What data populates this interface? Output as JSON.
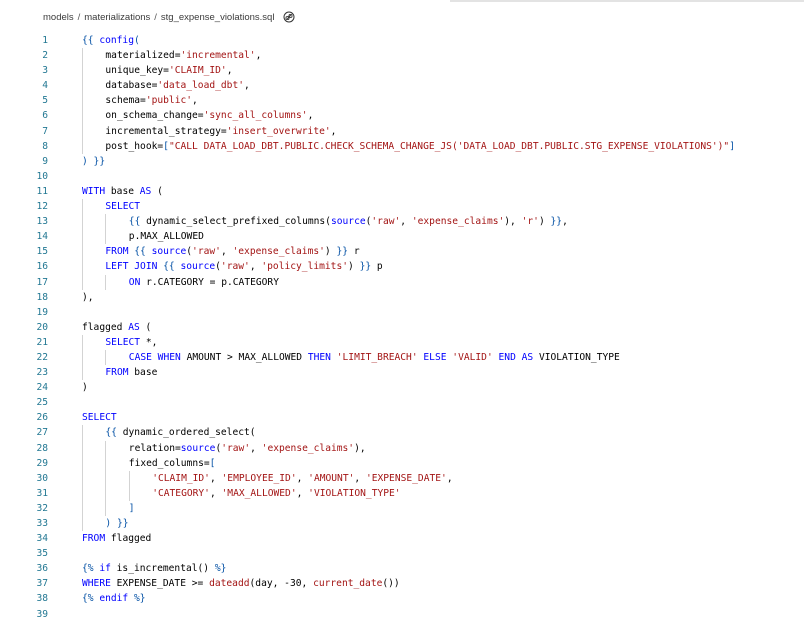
{
  "breadcrumb": {
    "parts": [
      "models",
      "materializations",
      "stg_expense_violations.sql"
    ],
    "separator": "/"
  },
  "icons": {
    "copy_path": "copy-link-icon"
  },
  "colors": {
    "keyword": "#0000ff",
    "string": "#a31515",
    "brace": "#0451a5",
    "text": "#000000",
    "line_number": "#237893"
  },
  "editor": {
    "lines": [
      {
        "n": "1",
        "indent": 0,
        "tokens": [
          {
            "t": "{{ ",
            "c": "brace"
          },
          {
            "t": "config",
            "c": "kw"
          },
          {
            "t": "(",
            "c": "brace"
          }
        ]
      },
      {
        "n": "2",
        "indent": 1,
        "tokens": [
          {
            "t": "materialized=",
            "c": "plain"
          },
          {
            "t": "'incremental'",
            "c": "str"
          },
          {
            "t": ",",
            "c": "plain"
          }
        ]
      },
      {
        "n": "3",
        "indent": 1,
        "tokens": [
          {
            "t": "unique_key=",
            "c": "plain"
          },
          {
            "t": "'CLAIM_ID'",
            "c": "str"
          },
          {
            "t": ",",
            "c": "plain"
          }
        ]
      },
      {
        "n": "4",
        "indent": 1,
        "tokens": [
          {
            "t": "database=",
            "c": "plain"
          },
          {
            "t": "'data_load_dbt'",
            "c": "str"
          },
          {
            "t": ",",
            "c": "plain"
          }
        ]
      },
      {
        "n": "5",
        "indent": 1,
        "tokens": [
          {
            "t": "schema=",
            "c": "plain"
          },
          {
            "t": "'public'",
            "c": "str"
          },
          {
            "t": ",",
            "c": "plain"
          }
        ]
      },
      {
        "n": "6",
        "indent": 1,
        "tokens": [
          {
            "t": "on_schema_change=",
            "c": "plain"
          },
          {
            "t": "'sync_all_columns'",
            "c": "str"
          },
          {
            "t": ",",
            "c": "plain"
          }
        ]
      },
      {
        "n": "7",
        "indent": 1,
        "tokens": [
          {
            "t": "incremental_strategy=",
            "c": "plain"
          },
          {
            "t": "'insert_overwrite'",
            "c": "str"
          },
          {
            "t": ",",
            "c": "plain"
          }
        ]
      },
      {
        "n": "8",
        "indent": 1,
        "tokens": [
          {
            "t": "post_hook=",
            "c": "plain"
          },
          {
            "t": "[",
            "c": "brace"
          },
          {
            "t": "\"CALL DATA_LOAD_DBT.PUBLIC.CHECK_SCHEMA_CHANGE_JS('DATA_LOAD_DBT.PUBLIC.STG_EXPENSE_VIOLATIONS')\"",
            "c": "str"
          },
          {
            "t": "]",
            "c": "brace"
          }
        ]
      },
      {
        "n": "9",
        "indent": 0,
        "tokens": [
          {
            "t": ") }}",
            "c": "brace"
          }
        ]
      },
      {
        "n": "10",
        "indent": 0,
        "tokens": []
      },
      {
        "n": "11",
        "indent": 0,
        "tokens": [
          {
            "t": "WITH ",
            "c": "kw"
          },
          {
            "t": "base ",
            "c": "plain"
          },
          {
            "t": "AS ",
            "c": "kw"
          },
          {
            "t": "(",
            "c": "plain"
          }
        ]
      },
      {
        "n": "12",
        "indent": 1,
        "tokens": [
          {
            "t": "SELECT",
            "c": "kw"
          }
        ]
      },
      {
        "n": "13",
        "indent": 2,
        "tokens": [
          {
            "t": "{{ ",
            "c": "brace"
          },
          {
            "t": "dynamic_select_prefixed_columns(",
            "c": "plain"
          },
          {
            "t": "source",
            "c": "kw"
          },
          {
            "t": "(",
            "c": "plain"
          },
          {
            "t": "'raw'",
            "c": "str"
          },
          {
            "t": ", ",
            "c": "plain"
          },
          {
            "t": "'expense_claims'",
            "c": "str"
          },
          {
            "t": "), ",
            "c": "plain"
          },
          {
            "t": "'r'",
            "c": "str"
          },
          {
            "t": ") ",
            "c": "plain"
          },
          {
            "t": "}}",
            "c": "brace"
          },
          {
            "t": ",",
            "c": "plain"
          }
        ]
      },
      {
        "n": "14",
        "indent": 2,
        "tokens": [
          {
            "t": "p.MAX_ALLOWED",
            "c": "plain"
          }
        ]
      },
      {
        "n": "15",
        "indent": 1,
        "tokens": [
          {
            "t": "FROM ",
            "c": "kw"
          },
          {
            "t": "{{ ",
            "c": "brace"
          },
          {
            "t": "source",
            "c": "kw"
          },
          {
            "t": "(",
            "c": "plain"
          },
          {
            "t": "'raw'",
            "c": "str"
          },
          {
            "t": ", ",
            "c": "plain"
          },
          {
            "t": "'expense_claims'",
            "c": "str"
          },
          {
            "t": ") ",
            "c": "plain"
          },
          {
            "t": "}}",
            "c": "brace"
          },
          {
            "t": " r",
            "c": "plain"
          }
        ]
      },
      {
        "n": "16",
        "indent": 1,
        "tokens": [
          {
            "t": "LEFT JOIN ",
            "c": "kw"
          },
          {
            "t": "{{ ",
            "c": "brace"
          },
          {
            "t": "source",
            "c": "kw"
          },
          {
            "t": "(",
            "c": "plain"
          },
          {
            "t": "'raw'",
            "c": "str"
          },
          {
            "t": ", ",
            "c": "plain"
          },
          {
            "t": "'policy_limits'",
            "c": "str"
          },
          {
            "t": ") ",
            "c": "plain"
          },
          {
            "t": "}}",
            "c": "brace"
          },
          {
            "t": " p",
            "c": "plain"
          }
        ]
      },
      {
        "n": "17",
        "indent": 2,
        "tokens": [
          {
            "t": "ON ",
            "c": "kw"
          },
          {
            "t": "r.CATEGORY = p.CATEGORY",
            "c": "plain"
          }
        ]
      },
      {
        "n": "18",
        "indent": 0,
        "tokens": [
          {
            "t": "),",
            "c": "plain"
          }
        ]
      },
      {
        "n": "19",
        "indent": 0,
        "tokens": []
      },
      {
        "n": "20",
        "indent": 0,
        "tokens": [
          {
            "t": "flagged ",
            "c": "plain"
          },
          {
            "t": "AS ",
            "c": "kw"
          },
          {
            "t": "(",
            "c": "plain"
          }
        ]
      },
      {
        "n": "21",
        "indent": 1,
        "tokens": [
          {
            "t": "SELECT ",
            "c": "kw"
          },
          {
            "t": "*,",
            "c": "plain"
          }
        ]
      },
      {
        "n": "22",
        "indent": 2,
        "tokens": [
          {
            "t": "CASE WHEN ",
            "c": "kw"
          },
          {
            "t": "AMOUNT > MAX_ALLOWED ",
            "c": "plain"
          },
          {
            "t": "THEN ",
            "c": "kw"
          },
          {
            "t": "'LIMIT_BREACH'",
            "c": "str"
          },
          {
            "t": " ",
            "c": "plain"
          },
          {
            "t": "ELSE ",
            "c": "kw"
          },
          {
            "t": "'VALID'",
            "c": "str"
          },
          {
            "t": " ",
            "c": "plain"
          },
          {
            "t": "END AS ",
            "c": "kw"
          },
          {
            "t": "VIOLATION_TYPE",
            "c": "plain"
          }
        ]
      },
      {
        "n": "23",
        "indent": 1,
        "tokens": [
          {
            "t": "FROM ",
            "c": "kw"
          },
          {
            "t": "base",
            "c": "plain"
          }
        ]
      },
      {
        "n": "24",
        "indent": 0,
        "tokens": [
          {
            "t": ")",
            "c": "plain"
          }
        ]
      },
      {
        "n": "25",
        "indent": 0,
        "tokens": []
      },
      {
        "n": "26",
        "indent": 0,
        "tokens": [
          {
            "t": "SELECT",
            "c": "kw"
          }
        ]
      },
      {
        "n": "27",
        "indent": 1,
        "tokens": [
          {
            "t": "{{ ",
            "c": "brace"
          },
          {
            "t": "dynamic_ordered_select(",
            "c": "plain"
          }
        ]
      },
      {
        "n": "28",
        "indent": 2,
        "tokens": [
          {
            "t": "relation=",
            "c": "plain"
          },
          {
            "t": "source",
            "c": "kw"
          },
          {
            "t": "(",
            "c": "plain"
          },
          {
            "t": "'raw'",
            "c": "str"
          },
          {
            "t": ", ",
            "c": "plain"
          },
          {
            "t": "'expense_claims'",
            "c": "str"
          },
          {
            "t": "),",
            "c": "plain"
          }
        ]
      },
      {
        "n": "29",
        "indent": 2,
        "tokens": [
          {
            "t": "fixed_columns=",
            "c": "plain"
          },
          {
            "t": "[",
            "c": "brace"
          }
        ]
      },
      {
        "n": "30",
        "indent": 3,
        "tokens": [
          {
            "t": "'CLAIM_ID'",
            "c": "str"
          },
          {
            "t": ", ",
            "c": "plain"
          },
          {
            "t": "'EMPLOYEE_ID'",
            "c": "str"
          },
          {
            "t": ", ",
            "c": "plain"
          },
          {
            "t": "'AMOUNT'",
            "c": "str"
          },
          {
            "t": ", ",
            "c": "plain"
          },
          {
            "t": "'EXPENSE_DATE'",
            "c": "str"
          },
          {
            "t": ",",
            "c": "plain"
          }
        ]
      },
      {
        "n": "31",
        "indent": 3,
        "tokens": [
          {
            "t": "'CATEGORY'",
            "c": "str"
          },
          {
            "t": ", ",
            "c": "plain"
          },
          {
            "t": "'MAX_ALLOWED'",
            "c": "str"
          },
          {
            "t": ", ",
            "c": "plain"
          },
          {
            "t": "'VIOLATION_TYPE'",
            "c": "str"
          }
        ]
      },
      {
        "n": "32",
        "indent": 2,
        "tokens": [
          {
            "t": "]",
            "c": "brace"
          }
        ]
      },
      {
        "n": "33",
        "indent": 1,
        "tokens": [
          {
            "t": ") }}",
            "c": "brace"
          }
        ]
      },
      {
        "n": "34",
        "indent": 0,
        "tokens": [
          {
            "t": "FROM ",
            "c": "kw"
          },
          {
            "t": "flagged",
            "c": "plain"
          }
        ]
      },
      {
        "n": "35",
        "indent": 0,
        "tokens": []
      },
      {
        "n": "36",
        "indent": 0,
        "tokens": [
          {
            "t": "{% ",
            "c": "brace"
          },
          {
            "t": "if ",
            "c": "kw"
          },
          {
            "t": "is_incremental() ",
            "c": "plain"
          },
          {
            "t": "%}",
            "c": "brace"
          }
        ]
      },
      {
        "n": "37",
        "indent": 0,
        "tokens": [
          {
            "t": "WHERE ",
            "c": "kw"
          },
          {
            "t": "EXPENSE_DATE >= ",
            "c": "plain"
          },
          {
            "t": "dateadd",
            "c": "str"
          },
          {
            "t": "(day, -30, ",
            "c": "plain"
          },
          {
            "t": "current_date",
            "c": "str"
          },
          {
            "t": "())",
            "c": "plain"
          }
        ]
      },
      {
        "n": "38",
        "indent": 0,
        "tokens": [
          {
            "t": "{% ",
            "c": "brace"
          },
          {
            "t": "endif ",
            "c": "kw"
          },
          {
            "t": "%}",
            "c": "brace"
          }
        ]
      },
      {
        "n": "39",
        "indent": 0,
        "tokens": []
      }
    ]
  }
}
